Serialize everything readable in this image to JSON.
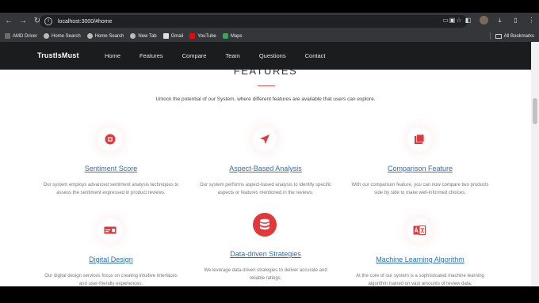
{
  "browser": {
    "url": "localhost:3000/#home",
    "bookmarks": [
      "AMD Driver",
      "Home Search",
      "Home Search",
      "New Tab",
      "Gmail",
      "YouTube",
      "Maps"
    ],
    "all_bookmarks_label": "All Bookmarks"
  },
  "site": {
    "brand": "TrustIsMust",
    "nav": [
      "Home",
      "Features",
      "Compare",
      "Team",
      "Questions",
      "Contact"
    ]
  },
  "section": {
    "title": "FEATURES",
    "subtitle": "Unlock the potential of our System, where different features are available that users can explore."
  },
  "features": [
    {
      "title": "Sentiment Score",
      "icon": "stop-circle-icon",
      "desc_1": "Our system employs advanced sentiment analysis techniques to",
      "desc_2": "assess the sentiment expressed in product reviews."
    },
    {
      "title": "Aspect-Based Analysis",
      "icon": "navigation-arrow-icon",
      "desc_1": "Our system performs aspect-based analysis to identify specific",
      "desc_2": "aspects or features mentioned in the reviews."
    },
    {
      "title": "Comparison Feature",
      "icon": "copy-squares-icon",
      "desc_1": "With our comparison feature, you can now compare two products",
      "desc_2": "side by side to make well-informed choices."
    },
    {
      "title": "Digital Design",
      "icon": "design-card-icon",
      "desc_1": "Our digital design services focus on creating intuitive interfaces",
      "desc_2": "and user-friendly experiences."
    },
    {
      "title": "Data-driven Strategies",
      "icon": "database-icon",
      "desc_1": "We leverage data-driven strategies to deliver accurate and",
      "desc_2": "reliable ratings."
    },
    {
      "title": "Machine Learning Algorithm",
      "icon": "translate-icon",
      "desc_1": "At the core of our system is a sophisticated machine learning",
      "desc_2": "algorithm trained on vast amounts of review data."
    }
  ],
  "colors": {
    "accent": "#e2383c",
    "link": "#2a6ebd",
    "navbar": "#1b1c1e"
  }
}
